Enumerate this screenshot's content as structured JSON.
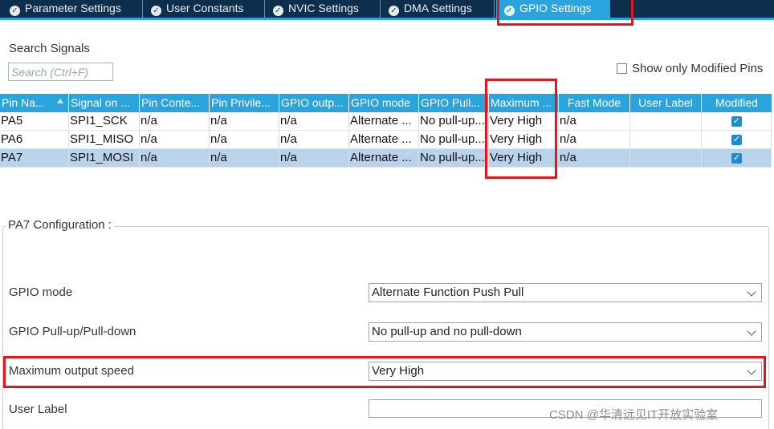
{
  "tabs": [
    {
      "label": "Parameter Settings",
      "active": false
    },
    {
      "label": "User Constants",
      "active": false
    },
    {
      "label": "NVIC Settings",
      "active": false
    },
    {
      "label": "DMA Settings",
      "active": false
    },
    {
      "label": "GPIO Settings",
      "active": true
    }
  ],
  "search": {
    "label": "Search Signals",
    "placeholder": "Search (Ctrl+F)"
  },
  "show_modified": {
    "label": "Show only Modified Pins",
    "checked": false
  },
  "table": {
    "columns": [
      "Pin Na...",
      "Signal on ...",
      "Pin Conte...",
      "Pin Privile...",
      "GPIO outp...",
      "GPIO mode",
      "GPIO Pull...",
      "Maximum ...",
      "Fast Mode",
      "User Label",
      "Modified"
    ],
    "rows": [
      {
        "pin": "PA5",
        "signal": "SPI1_SCK",
        "context": "n/a",
        "privilege": "n/a",
        "output": "n/a",
        "mode": "Alternate ...",
        "pull": "No pull-up...",
        "speed": "Very High",
        "fast": "n/a",
        "label": "",
        "modified": true
      },
      {
        "pin": "PA6",
        "signal": "SPI1_MISO",
        "context": "n/a",
        "privilege": "n/a",
        "output": "n/a",
        "mode": "Alternate ...",
        "pull": "No pull-up...",
        "speed": "Very High",
        "fast": "n/a",
        "label": "",
        "modified": true
      },
      {
        "pin": "PA7",
        "signal": "SPI1_MOSI",
        "context": "n/a",
        "privilege": "n/a",
        "output": "n/a",
        "mode": "Alternate ...",
        "pull": "No pull-up...",
        "speed": "Very High",
        "fast": "n/a",
        "label": "",
        "modified": true,
        "selected": true
      }
    ]
  },
  "config": {
    "title": "PA7 Configuration :",
    "gpio_mode": {
      "label": "GPIO mode",
      "value": "Alternate Function Push Pull"
    },
    "pull": {
      "label": "GPIO Pull-up/Pull-down",
      "value": "No pull-up and no pull-down"
    },
    "speed": {
      "label": "Maximum output speed",
      "value": "Very High"
    },
    "user_label": {
      "label": "User Label",
      "value": ""
    }
  },
  "watermark": "CSDN @华清远见IT开放实验室",
  "colors": {
    "accent": "#2aa4dc",
    "tab_bg": "#0d2f4d",
    "highlight": "#e3161b",
    "selected_row": "#b9d3ea"
  }
}
